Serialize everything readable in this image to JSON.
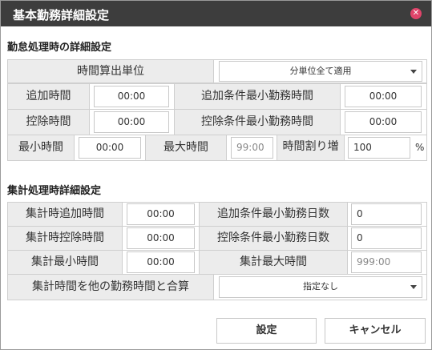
{
  "dialog": {
    "title": "基本勤務詳細設定",
    "close_icon": "✕"
  },
  "section1": {
    "title": "勤怠処理時の詳細設定",
    "calc_unit_label": "時間算出単位",
    "calc_unit_value": "分単位全て適用",
    "add_time_label": "追加時間",
    "add_time_value": "00:00",
    "add_min_label": "追加条件最小勤務時間",
    "add_min_value": "00:00",
    "deduct_time_label": "控除時間",
    "deduct_time_value": "00:00",
    "deduct_min_label": "控除条件最小勤務時間",
    "deduct_min_value": "00:00",
    "min_time_label": "最小時間",
    "min_time_value": "00:00",
    "max_time_label": "最大時間",
    "max_time_value": "99:00",
    "rate_label": "時間割り増",
    "rate_value": "100",
    "rate_unit": "%"
  },
  "section2": {
    "title": "集計処理時詳細設定",
    "sum_add_label": "集計時追加時間",
    "sum_add_value": "00:00",
    "add_min_days_label": "追加条件最小勤務日数",
    "add_min_days_value": "0",
    "sum_deduct_label": "集計時控除時間",
    "sum_deduct_value": "00:00",
    "deduct_min_days_label": "控除条件最小勤務日数",
    "deduct_min_days_value": "0",
    "sum_min_label": "集計最小時間",
    "sum_min_value": "00:00",
    "sum_max_label": "集計最大時間",
    "sum_max_value": "999:00",
    "combine_label": "集計時間を他の勤務時間と合算",
    "combine_value": "指定なし"
  },
  "buttons": {
    "ok": "設定",
    "cancel": "キャンセル"
  }
}
